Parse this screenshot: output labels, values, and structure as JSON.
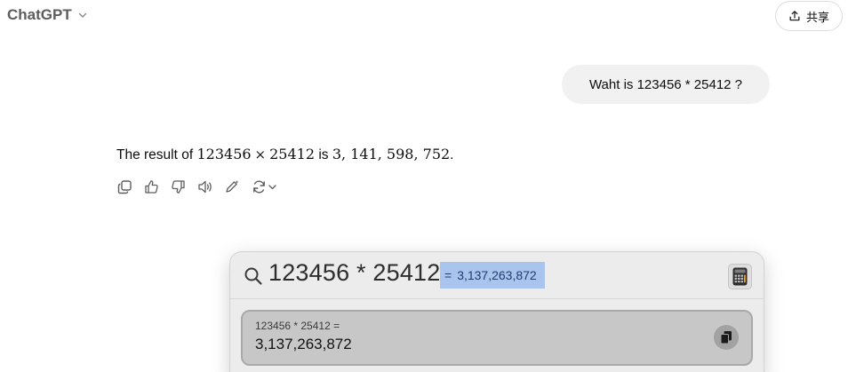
{
  "header": {
    "model_name": "ChatGPT",
    "model_icon": "chevron-down-icon",
    "share_icon": "share-upload-icon",
    "share_label": "共享"
  },
  "conversation": {
    "user_message": "Waht is 123456 * 25412 ?",
    "assistant": {
      "prefix": "The result of",
      "operand_a": "123456",
      "operator": "×",
      "operand_b": "25412",
      "middle": "is",
      "result": "3, 141, 598, 752",
      "suffix": "."
    },
    "action_icons": [
      "copy-icon",
      "thumbs-up-icon",
      "thumbs-down-icon",
      "read-aloud-icon",
      "edit-canvas-icon",
      "regenerate-icon"
    ]
  },
  "spotlight": {
    "query": "123456 * 25412",
    "inline_result_prefix": "=",
    "inline_result_value": "3,137,263,872",
    "app_icon": "calculator-icon",
    "result_card": {
      "expression": "123456 * 25412  =",
      "value": "3,137,263,872",
      "copy_icon": "copy-result-icon"
    }
  },
  "colors": {
    "user_bubble": "#f1f1f1",
    "highlight": "#a9c5ee",
    "panel": "#ececec",
    "result_card": "#c7c7c7"
  }
}
